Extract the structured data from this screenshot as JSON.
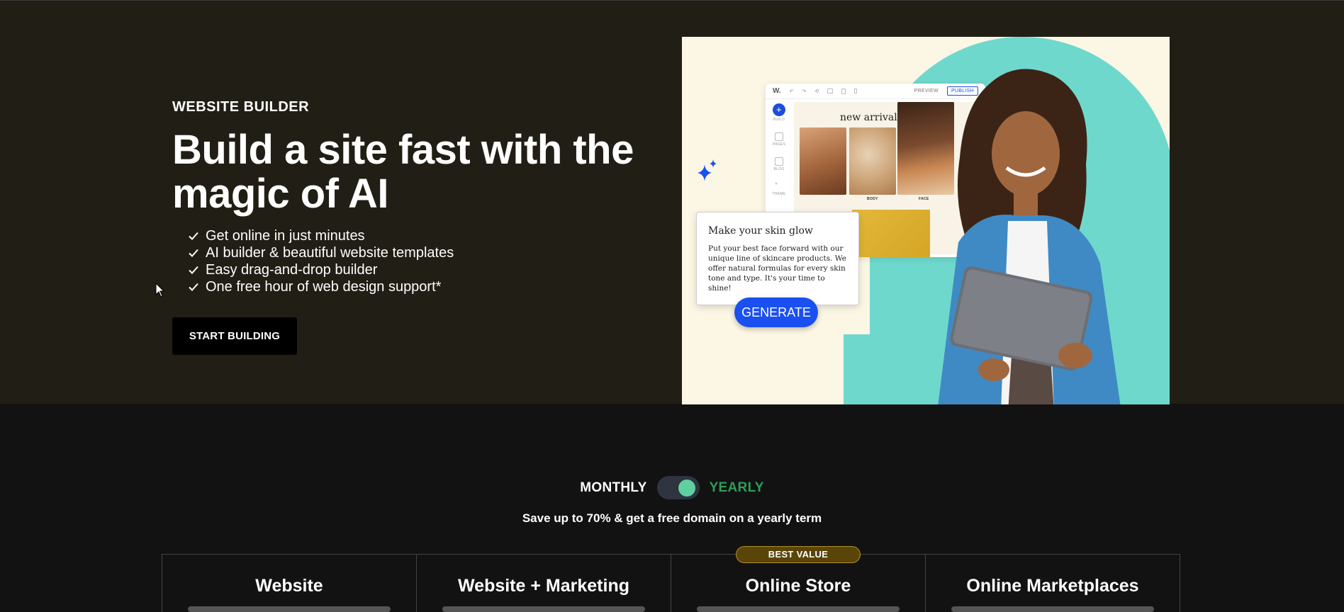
{
  "hero": {
    "eyebrow": "WEBSITE BUILDER",
    "headline": "Build a site fast with the magic of AI",
    "features": [
      "Get online in just minutes",
      "AI builder & beautiful website templates",
      "Easy drag-and-drop builder",
      "One free hour of web design support*"
    ],
    "cta_label": "START BUILDING"
  },
  "hero_image": {
    "editor": {
      "logo": "W.",
      "preview_label": "PREVIEW",
      "publish_label": "PUBLISH",
      "side_items": [
        "BUILD",
        "PAGES",
        "BLOG",
        "THEME"
      ],
      "canvas_title": "new arrivals",
      "product_captions": [
        "BODY",
        "FACE"
      ]
    },
    "ai_card": {
      "title": "Make your skin glow",
      "body": "Put your best face forward with our unique line of skincare products. We offer natural formulas for every skin tone and type. It's your time to shine!"
    },
    "generate_label": "GENERATE"
  },
  "pricing": {
    "toggle_monthly": "MONTHLY",
    "toggle_yearly": "YEARLY",
    "toggle_state": "yearly",
    "save_text": "Save up to 70% & get a free domain on a yearly term",
    "plans": [
      {
        "name": "Website",
        "badge": ""
      },
      {
        "name": "Website + Marketing",
        "badge": ""
      },
      {
        "name": "Online Store",
        "badge": "BEST VALUE"
      },
      {
        "name": "Online Marketplaces",
        "badge": ""
      }
    ]
  },
  "colors": {
    "hero_bg": "#211e15",
    "page_bg": "#121212",
    "accent_teal": "#6fd8cd",
    "generate_blue": "#1a4ff0",
    "yearly_green": "#2e9e58",
    "badge_gold": "#5a4508"
  },
  "icons": [
    "check-icon",
    "cursor-icon",
    "sparkle-icon",
    "plus-icon",
    "undo-icon",
    "redo-icon",
    "desktop-icon",
    "tablet-icon",
    "mobile-icon"
  ]
}
